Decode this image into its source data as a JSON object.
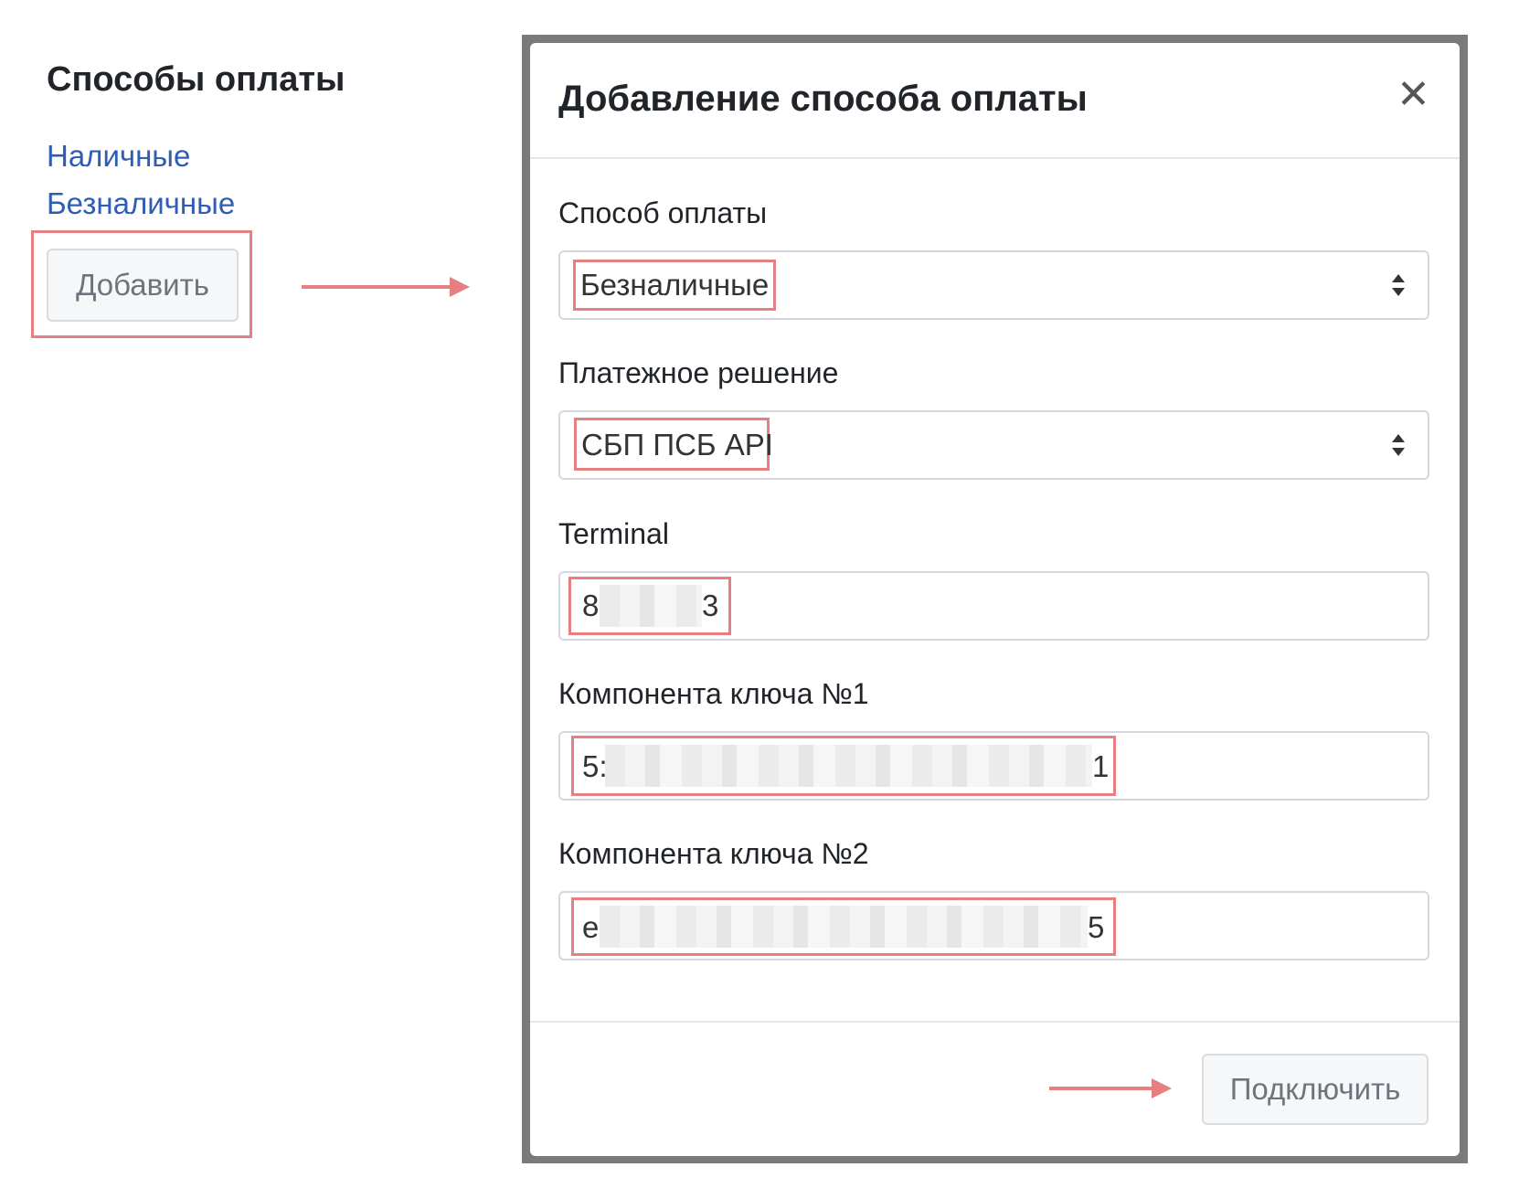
{
  "sidebar": {
    "title": "Способы оплаты",
    "methods": [
      "Наличные",
      "Безналичные"
    ],
    "add_label": "Добавить"
  },
  "modal": {
    "title": "Добавление способа оплаты",
    "close_icon": "close-icon",
    "fields": [
      {
        "label": "Способ оплаты",
        "value": "Безналичные",
        "type": "select"
      },
      {
        "label": "Платежное решение",
        "value": "СБП ПСБ API",
        "type": "select"
      },
      {
        "label": "Terminal",
        "value_start": "8",
        "value_end": "3",
        "type": "input"
      },
      {
        "label": "Компонента ключа №1",
        "value_start": "5:",
        "value_end": "1",
        "type": "input"
      },
      {
        "label": "Компонента ключа №2",
        "value_start": "e",
        "value_end": "5",
        "type": "input"
      }
    ],
    "submit_label": "Подключить"
  },
  "colors": {
    "highlight": "#e57f80",
    "link": "#2f5db6"
  }
}
